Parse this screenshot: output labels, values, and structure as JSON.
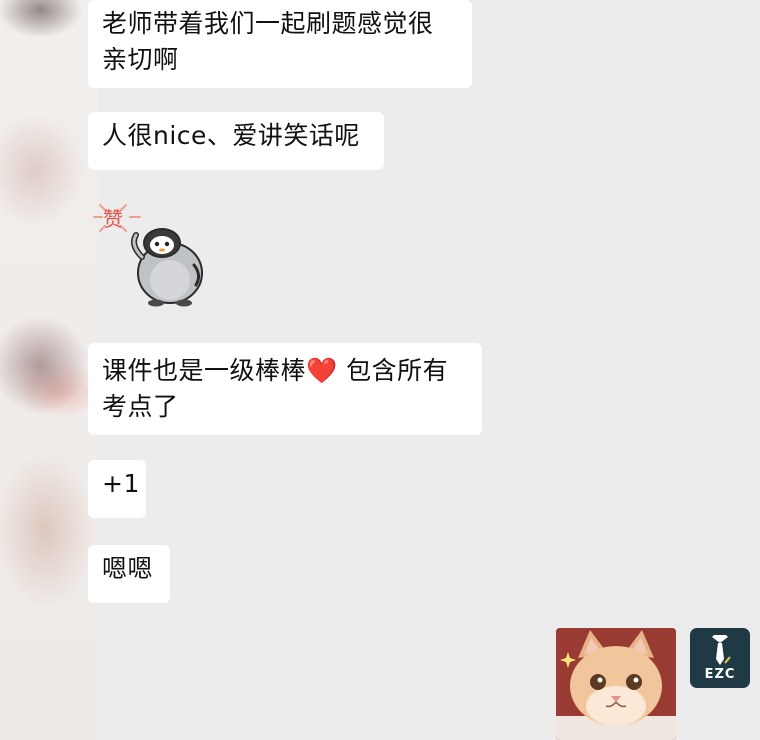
{
  "messages": [
    {
      "lines": [
        "老师带着我们一起刷题感觉很",
        "亲切啊"
      ]
    },
    {
      "lines": [
        "人很nice、爱讲笑话呢"
      ]
    },
    {
      "sticker_icon": "penguin-thumbs-up-sticker",
      "sticker_text": "赞"
    },
    {
      "lines": [
        "课件也是一级棒棒",
        "考点了"
      ],
      "inline_emoji": "❤️",
      "after_emoji": " 包含所有"
    },
    {
      "lines": [
        "+1"
      ]
    },
    {
      "lines": [
        "嗯嗯"
      ]
    }
  ],
  "self": {
    "avatar_label": "EZC",
    "image_icon": "cat-photo"
  },
  "colors": {
    "background": "#ececec",
    "bubble": "#ffffff",
    "heart": "#e8303a",
    "avatar_bg": "#1f3a44"
  }
}
